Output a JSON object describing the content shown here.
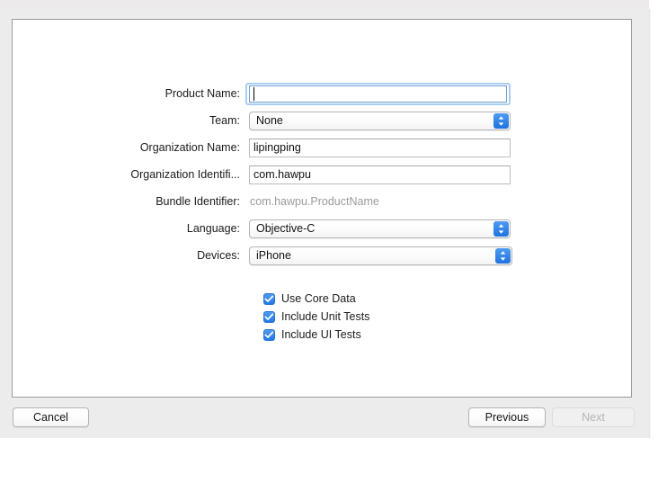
{
  "window": {
    "title_remnant": "",
    "background_color": "#ececec",
    "accent_color": "#2379e4"
  },
  "dialog": {
    "name": "new-project-options-sheet"
  },
  "form": {
    "rows": [
      {
        "id": "product-name",
        "label": "Product Name:",
        "type": "text",
        "value": "",
        "placeholder": "",
        "focused": true
      },
      {
        "id": "team",
        "label": "Team:",
        "type": "popup",
        "value": "None"
      },
      {
        "id": "organization-name",
        "label": "Organization Name:",
        "type": "text",
        "value": "lipingping",
        "placeholder": "",
        "focused": false
      },
      {
        "id": "organization-identifier",
        "label": "Organization Identifi...",
        "type": "text",
        "value": "com.hawpu",
        "placeholder": "",
        "focused": false
      },
      {
        "id": "bundle-identifier",
        "label": "Bundle Identifier:",
        "type": "static",
        "value": "com.hawpu.ProductName"
      },
      {
        "id": "language",
        "label": "Language:",
        "type": "popup",
        "value": "Objective-C"
      },
      {
        "id": "devices",
        "label": "Devices:",
        "type": "popup",
        "value": "iPhone"
      }
    ]
  },
  "checkboxes": [
    {
      "id": "use-core-data",
      "label": "Use Core Data",
      "checked": true
    },
    {
      "id": "include-unit-tests",
      "label": "Include Unit Tests",
      "checked": true
    },
    {
      "id": "include-ui-tests",
      "label": "Include UI Tests",
      "checked": true
    }
  ],
  "footer": {
    "cancel_label": "Cancel",
    "previous_label": "Previous",
    "next_label": "Next",
    "next_disabled": true
  }
}
